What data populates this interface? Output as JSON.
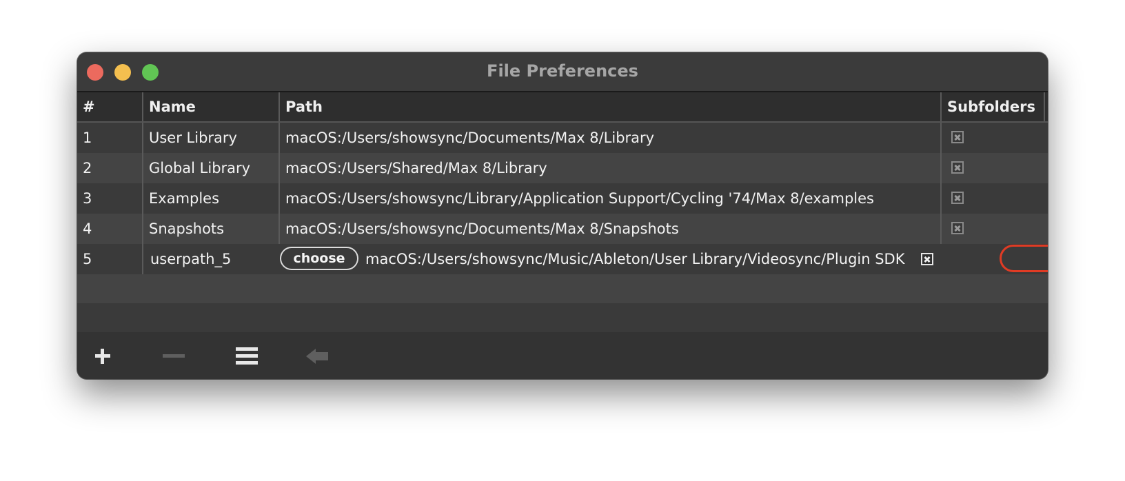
{
  "window": {
    "title": "File Preferences",
    "controls": [
      "close",
      "minimize",
      "zoom"
    ]
  },
  "table": {
    "columns": [
      "#",
      "Name",
      "Path",
      "Subfolders"
    ],
    "rows": [
      {
        "num": "1",
        "name": "User Library",
        "path": "macOS:/Users/showsync/Documents/Max 8/Library",
        "subfolders": true
      },
      {
        "num": "2",
        "name": "Global Library",
        "path": "macOS:/Users/Shared/Max 8/Library",
        "subfolders": true
      },
      {
        "num": "3",
        "name": "Examples",
        "path": "macOS:/Users/showsync/Library/Application Support/Cycling '74/Max 8/examples",
        "subfolders": true
      },
      {
        "num": "4",
        "name": "Snapshots",
        "path": "macOS:/Users/showsync/Documents/Max 8/Snapshots",
        "subfolders": true
      },
      {
        "num": "5",
        "name": "userpath_5",
        "choose_label": "choose",
        "path": "macOS:/Users/showsync/Music/Ableton/User Library/Videosync/Plugin SDK",
        "subfolders": true,
        "editable": true
      }
    ]
  },
  "toolbar": {
    "buttons": [
      {
        "icon": "plus-icon",
        "label": "Add path",
        "enabled": true
      },
      {
        "icon": "minus-icon",
        "label": "Remove path",
        "enabled": false
      },
      {
        "icon": "list-icon",
        "label": "Options",
        "enabled": true
      },
      {
        "icon": "back-arrow-icon",
        "label": "Back",
        "enabled": false
      }
    ]
  },
  "annotation": {
    "color": "#e03b24",
    "target": "row-5-path-end-and-subfolders"
  }
}
